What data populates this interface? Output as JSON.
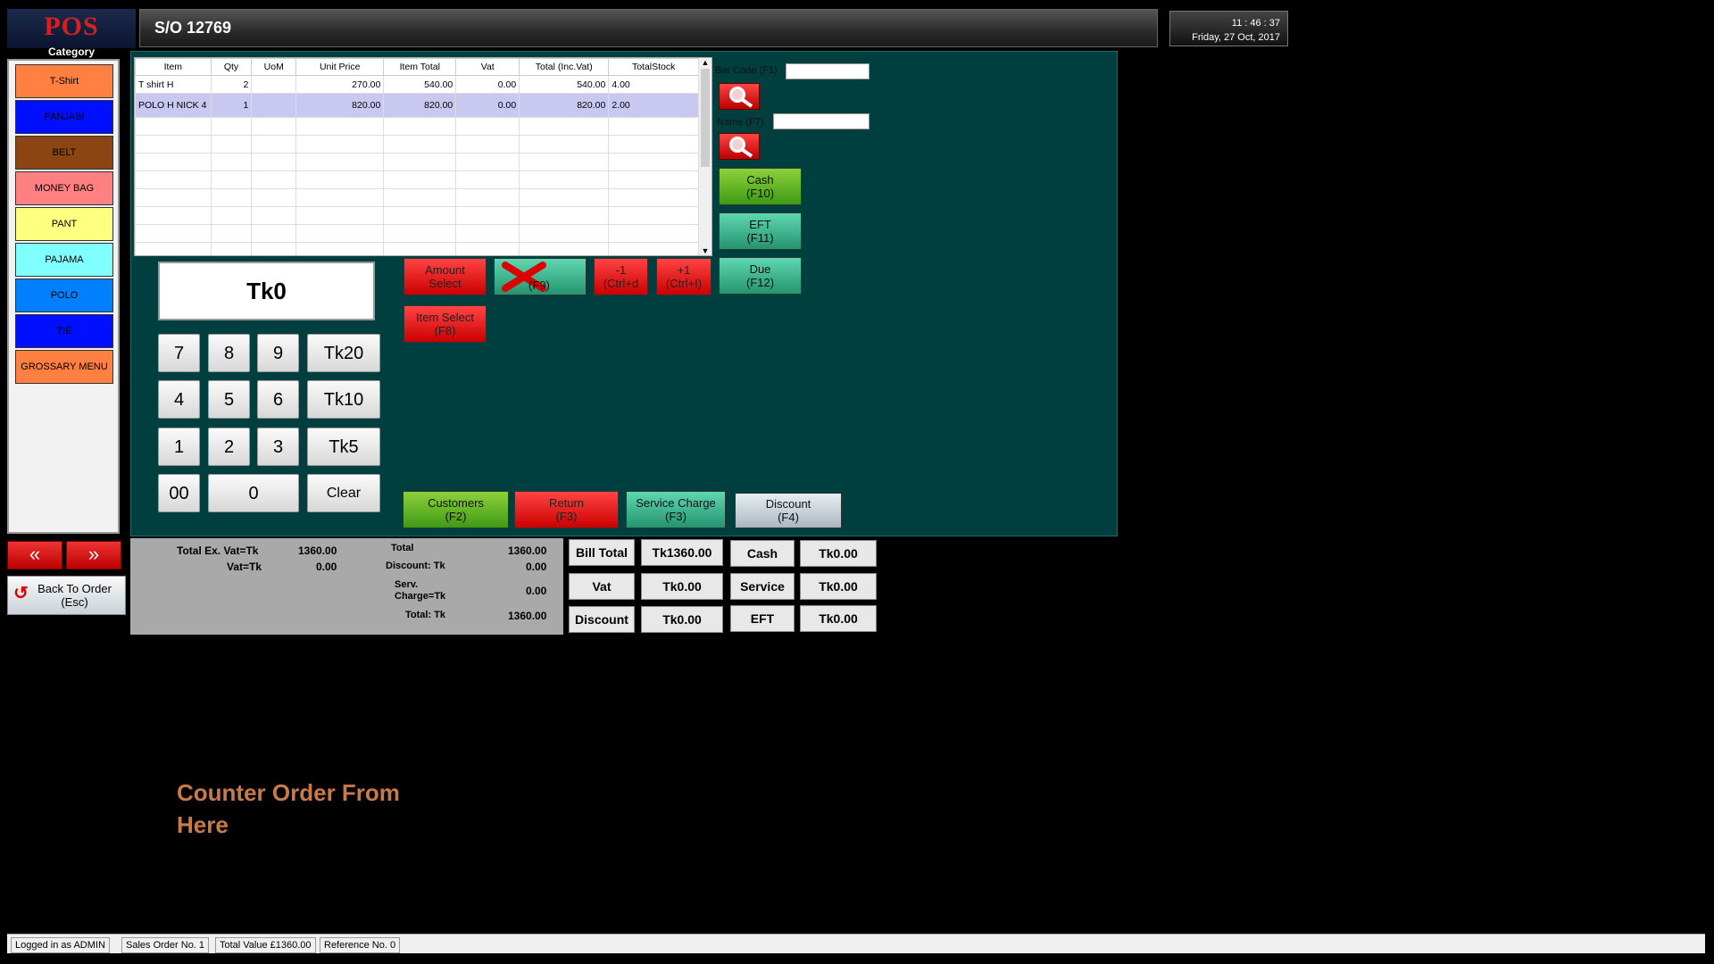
{
  "header": {
    "logo": "POS",
    "category_label": "Category",
    "title": "S/O 12769",
    "time": "11 : 46 : 37",
    "date": "Friday, 27 Oct, 2017"
  },
  "categories": [
    {
      "label": "T-Shirt",
      "color": "#ff8040"
    },
    {
      "label": "PANJABI",
      "color": "#0010ff"
    },
    {
      "label": "BELT",
      "color": "#8b4513"
    },
    {
      "label": "MONEY BAG",
      "color": "#ff8080"
    },
    {
      "label": "PANT",
      "color": "#ffff80"
    },
    {
      "label": "PAJAMA",
      "color": "#80ffff"
    },
    {
      "label": "POLO",
      "color": "#0080ff"
    },
    {
      "label": "TIE",
      "color": "#0010ff"
    },
    {
      "label": "GROSSARY MENU",
      "color": "#ff8040"
    }
  ],
  "nav": {
    "prev": "«",
    "next": "»",
    "back_line1": "Back To Order",
    "back_line2": "(Esc)"
  },
  "grid": {
    "columns": [
      "Item",
      "Qty",
      "UoM",
      "Unit Price",
      "Item Total",
      "Vat",
      "Total (Inc.Vat)",
      "TotalStock"
    ],
    "rows": [
      [
        "T shirt H",
        "2",
        "",
        "270.00",
        "540.00",
        "0.00",
        "540.00",
        "4.00"
      ],
      [
        "POLO H NICK 4",
        "1",
        "",
        "820.00",
        "820.00",
        "0.00",
        "820.00",
        "2.00"
      ]
    ]
  },
  "display": {
    "value": "Tk0"
  },
  "keypad": {
    "k7": "7",
    "k8": "8",
    "k9": "9",
    "tk20": "Tk20",
    "k4": "4",
    "k5": "5",
    "k6": "6",
    "tk10": "Tk10",
    "k1": "1",
    "k2": "2",
    "k3": "3",
    "tk5": "Tk5",
    "k00": "00",
    "k0": "0",
    "clear": "Clear"
  },
  "actions": {
    "amount_select_1": "Amount",
    "amount_select_2": "Select",
    "delete_key": "(F9)",
    "minus_1": "-1",
    "minus_2": "(Ctrl+d",
    "plus_1": "+1",
    "plus_2": "(Ctrl+I)",
    "item_select_1": "Item Select",
    "item_select_2": "(F8)"
  },
  "right": {
    "barcode_label": "Bar Code (F1)",
    "name_label": "Name (F7)",
    "cash_1": "Cash",
    "cash_2": "(F10)",
    "eft_1": "EFT",
    "eft_2": "(F11)",
    "due_1": "Due",
    "due_2": "(F12)"
  },
  "bottom_buttons": {
    "customers_1": "Customers",
    "customers_2": "(F2)",
    "return_1": "Return",
    "return_2": "(F3)",
    "service_1": "Service Charge",
    "service_2": "(F3)",
    "discount_1": "Discount",
    "discount_2": "(F4)"
  },
  "totals": {
    "ex_vat_label": "Total Ex. Vat=Tk",
    "ex_vat_value": "1360.00",
    "vat_label": "Vat=Tk",
    "vat_value": "0.00",
    "total_label": "Total",
    "total_value": "1360.00",
    "discount_label": "Discount: Tk",
    "discount_value": "0.00",
    "serv_label_1": "Serv.",
    "serv_label_2": "Charge=Tk",
    "serv_value": "0.00",
    "grand_label": "Total: Tk",
    "grand_value": "1360.00"
  },
  "summary": {
    "bill_total_label": "Bill Total",
    "bill_total_value": "Tk1360.00",
    "vat_label": "Vat",
    "vat_value": "Tk0.00",
    "discount_label": "Discount",
    "discount_value": "Tk0.00",
    "cash_label": "Cash",
    "cash_value": "Tk0.00",
    "service_label": "Service",
    "service_value": "Tk0.00",
    "eft_label": "EFT",
    "eft_value": "Tk0.00"
  },
  "annotation": {
    "line1": "Counter Order From",
    "line2": "Here"
  },
  "status": {
    "user": "Logged in as ADMIN",
    "order": "Sales Order No. 1",
    "value": "Total Value £1360.00",
    "ref": "Reference No. 0"
  }
}
